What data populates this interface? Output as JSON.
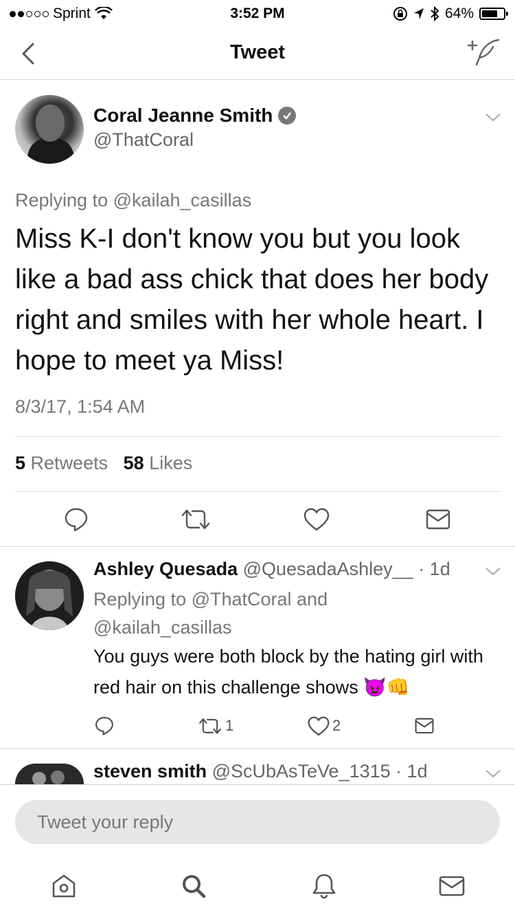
{
  "status_bar": {
    "carrier": "Sprint",
    "time": "3:52 PM",
    "battery": "64%"
  },
  "nav": {
    "title": "Tweet"
  },
  "tweet": {
    "author_name": "Coral Jeanne Smith",
    "author_handle": "@ThatCoral",
    "replying_to": "Replying to @kailah_casillas",
    "text": "Miss K-I don't know you but you look like a bad ass chick that does her body right and smiles with her whole heart. I hope to meet ya Miss!",
    "timestamp": "8/3/17, 1:54 AM",
    "retweets_count": "5",
    "retweets_label": "Retweets",
    "likes_count": "58",
    "likes_label": "Likes"
  },
  "replies": [
    {
      "name": "Ashley Quesada",
      "handle": "@QuesadaAshley__",
      "age": "· 1d",
      "replying_line1": "Replying to @ThatCoral and",
      "replying_line2": "@kailah_casillas",
      "text": "You guys were both block by the hating girl with red hair on this challenge shows 😈👊",
      "retweets": "1",
      "likes": "2"
    },
    {
      "name": "steven smith",
      "handle": "@ScUbAsTeVe_1315",
      "age": "· 1d"
    }
  ],
  "compose": {
    "placeholder": "Tweet your reply"
  },
  "icons": [
    "back-icon",
    "compose-tweet-icon",
    "chevron-down-icon",
    "reply-icon",
    "retweet-icon",
    "like-icon",
    "direct-message-icon",
    "home-icon",
    "search-icon",
    "notifications-icon",
    "messages-icon"
  ]
}
